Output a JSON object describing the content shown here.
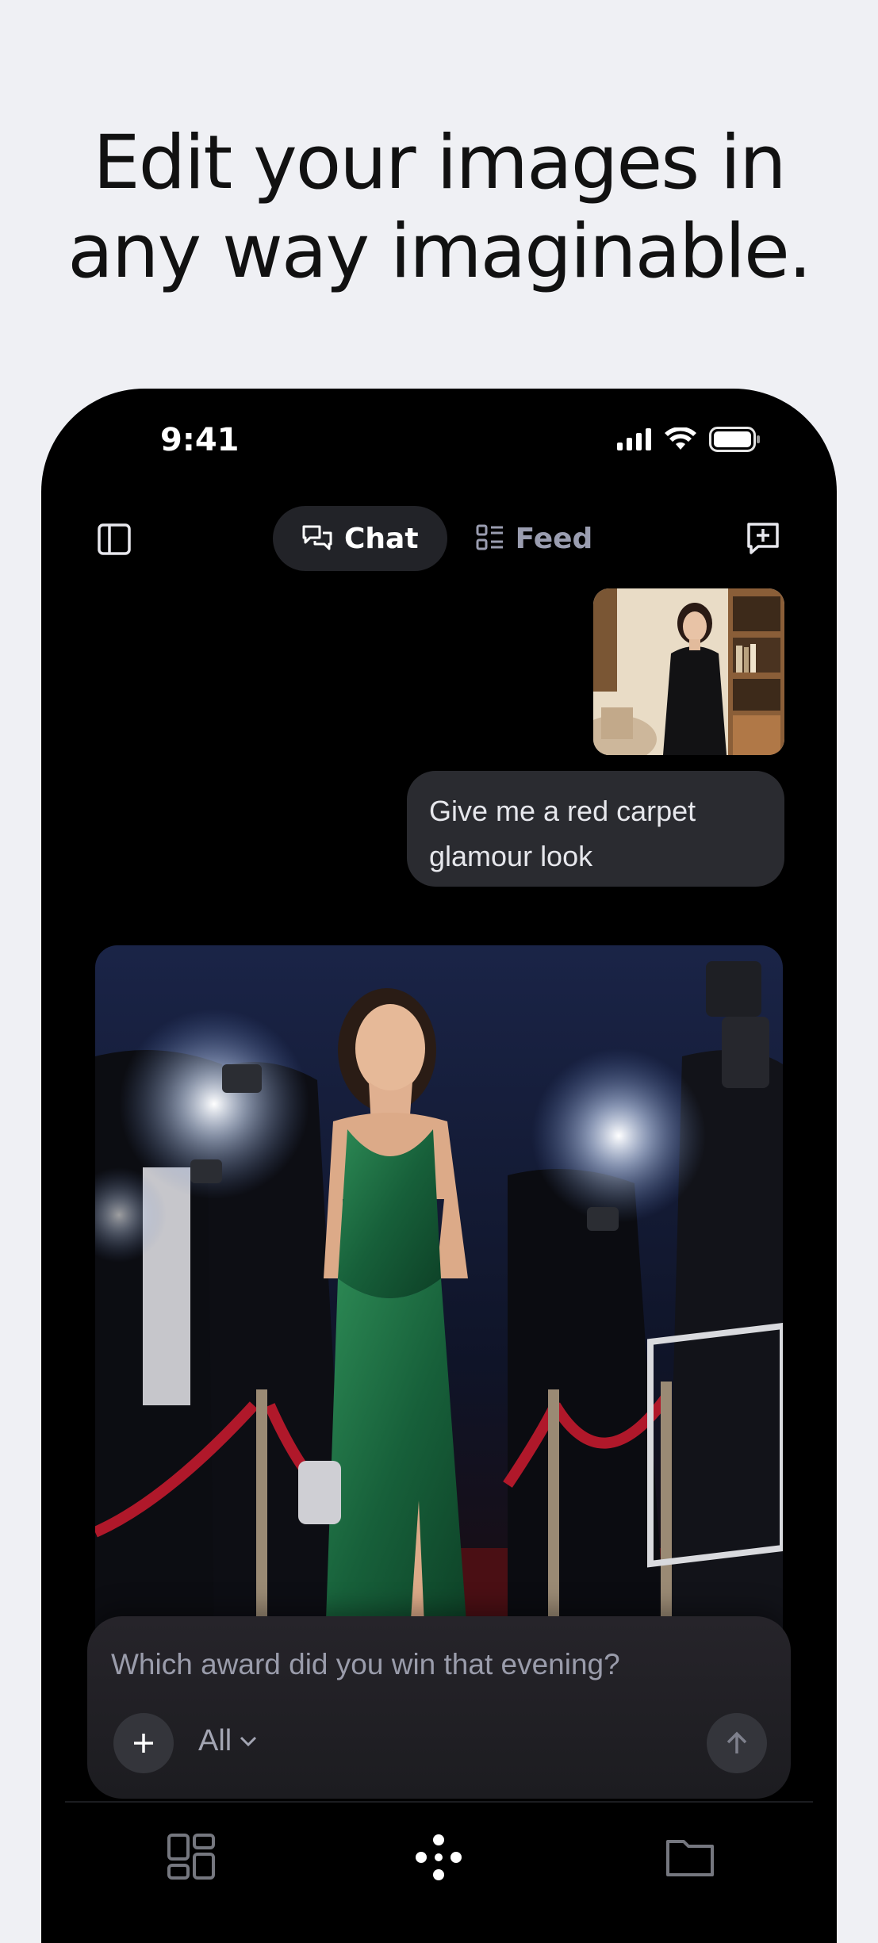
{
  "headline": {
    "line1": "Edit your images in",
    "line2": "any way imaginable."
  },
  "status_bar": {
    "time": "9:41",
    "icons": [
      "signal-icon",
      "wifi-icon",
      "battery-icon"
    ]
  },
  "topbar": {
    "sidebar_icon": "sidebar-panel-icon",
    "tabs": [
      {
        "label": "Chat",
        "icon": "chat-bubbles-icon",
        "active": true
      },
      {
        "label": "Feed",
        "icon": "feed-list-icon",
        "active": false
      }
    ],
    "new_chat_icon": "new-chat-icon"
  },
  "conversation": {
    "user_message": "Give me a red carpet glamour look",
    "user_photo": "woman in black dress in living room with bookshelves",
    "result_photo": "woman in green sequin gown on red carpet with photographers"
  },
  "composer": {
    "placeholder": "Which award did you win that evening?",
    "filter_label": "All"
  },
  "bottom_nav": {
    "items": [
      "grid-icon",
      "create-dots-icon",
      "folder-icon"
    ]
  },
  "colors": {
    "page_bg": "#eff0f4",
    "phone_bg": "#000000",
    "bubble_bg": "#2a2b30",
    "chat_tab_bg": "#222328",
    "gown_green": "#1d6b3f",
    "carpet_rope": "#b0182a"
  }
}
